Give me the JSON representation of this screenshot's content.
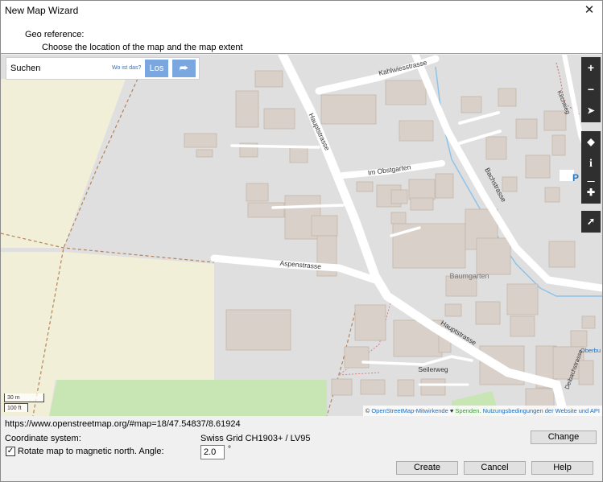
{
  "window": {
    "title": "New Map Wizard",
    "close_glyph": "✕"
  },
  "header": {
    "title": "Geo reference:",
    "subtitle": "Choose the location of the map and the map extent"
  },
  "search": {
    "placeholder": "Suchen",
    "wo_link": "Wo ist das?",
    "go_label": "Los",
    "directions_icon": "directions-icon"
  },
  "map_controls": {
    "zoom_in": "+",
    "zoom_out": "−",
    "locate": "➤",
    "layers": "◆",
    "info": "i",
    "share": "⇱",
    "note": "✚",
    "query": "➚"
  },
  "streets": {
    "kahlwiesstrasse": "Kahlwiesstrasse",
    "hauptstrasse_north": "Hauptstrasse",
    "hauptstrasse_south": "Hauptstrasse",
    "im_obstgarten": "Im Obstgarten",
    "bachstrasse": "Bachstrasse",
    "aspenstrasse": "Aspenstrasse",
    "seilerweg": "Seilerweg",
    "kirchweg": "Kirchweg",
    "baumgarten": "Baumgarten",
    "oberbuchsiten": "Oberbu",
    "deibachstrasse": "Deibachstrasse",
    "parking": "P"
  },
  "scale": {
    "metric": "30 m",
    "imperial": "100 ft"
  },
  "attribution": {
    "prefix": "© ",
    "osm": "OpenStreetMap-Mitwirkende",
    "heart": " ♥ ",
    "donate": "Spenden",
    "sep": ". ",
    "terms": "Nutzungsbedingungen der Website und API"
  },
  "footer": {
    "url": "https://www.openstreetmap.org/#map=18/47.54837/8.61924",
    "coord_label": "Coordinate system:",
    "coord_value": "Swiss Grid  CH1903+ / LV95",
    "change_label": "Change",
    "rotate_label": "Rotate map to magnetic north. Angle:",
    "rotate_checked": true,
    "angle_value": "2.0",
    "angle_unit": "°",
    "create_label": "Create",
    "cancel_label": "Cancel",
    "help_label": "Help"
  },
  "colors": {
    "road": "#ffffff",
    "building": "#d9d0c9",
    "building_stroke": "#c4b6ab",
    "grass": "#f2efd9",
    "park": "#c8e6b4",
    "landuse": "#e0dfdf",
    "stream": "#8dc3e8",
    "boundary": "#b3825a"
  }
}
